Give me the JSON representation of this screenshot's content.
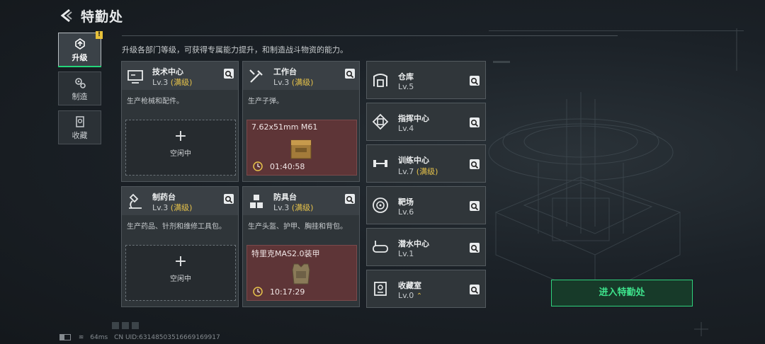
{
  "header": {
    "title": "特勤处",
    "description": "升级各部门等级，可获得专属能力提升，和制造战斗物资的能力。"
  },
  "nav": {
    "items": [
      {
        "label": "升级",
        "icon": "upgrade-icon"
      },
      {
        "label": "制造",
        "icon": "gears-icon"
      },
      {
        "label": "收藏",
        "icon": "collection-icon"
      }
    ],
    "badge": "!"
  },
  "colors": {
    "accent_green": "#2fd27c",
    "max_level_gold": "#e6c24a",
    "production_red": "#5e3537"
  },
  "departments": [
    {
      "name": "技术中心",
      "level": "Lv.3",
      "status": "(满级)",
      "desc": "生产枪械和配件。",
      "slot": {
        "type": "idle",
        "label": "空闲中"
      },
      "icon": "monitor-icon"
    },
    {
      "name": "工作台",
      "level": "Lv.3",
      "status": "(满级)",
      "desc": "生产子弹。",
      "slot": {
        "type": "producing",
        "item": "7.62x51mm M61",
        "time": "01:40:58"
      },
      "icon": "wrench-icon"
    },
    {
      "name": "制药台",
      "level": "Lv.3",
      "status": "(满级)",
      "desc": "生产药品、针剂和维修工具包。",
      "slot": {
        "type": "idle",
        "label": "空闲中"
      },
      "icon": "microscope-icon"
    },
    {
      "name": "防具台",
      "level": "Lv.3",
      "status": "(满级)",
      "desc": "生产头盔、护甲、胸挂和背包。",
      "slot": {
        "type": "producing",
        "item": "特里克MAS2.0装甲",
        "time": "10:17:29"
      },
      "icon": "cubes-icon"
    }
  ],
  "facilities": [
    {
      "name": "仓库",
      "level": "Lv.5",
      "status": "",
      "icon": "warehouse-icon"
    },
    {
      "name": "指挥中心",
      "level": "Lv.4",
      "status": "",
      "icon": "chip-icon"
    },
    {
      "name": "训练中心",
      "level": "Lv.7",
      "status": "(满级)",
      "icon": "dumbbell-icon"
    },
    {
      "name": "靶场",
      "level": "Lv.6",
      "status": "",
      "icon": "target-icon"
    },
    {
      "name": "潜水中心",
      "level": "Lv.1",
      "status": "",
      "icon": "diving-mask-icon"
    },
    {
      "name": "收藏室",
      "level": "Lv.0",
      "status": "",
      "icon": "trophy-icon",
      "upgrade": "⌃"
    }
  ],
  "enter_button": "进入特勤处",
  "footer": {
    "ping": "64ms",
    "uid": "CN UID:6314850351666916991​7"
  }
}
